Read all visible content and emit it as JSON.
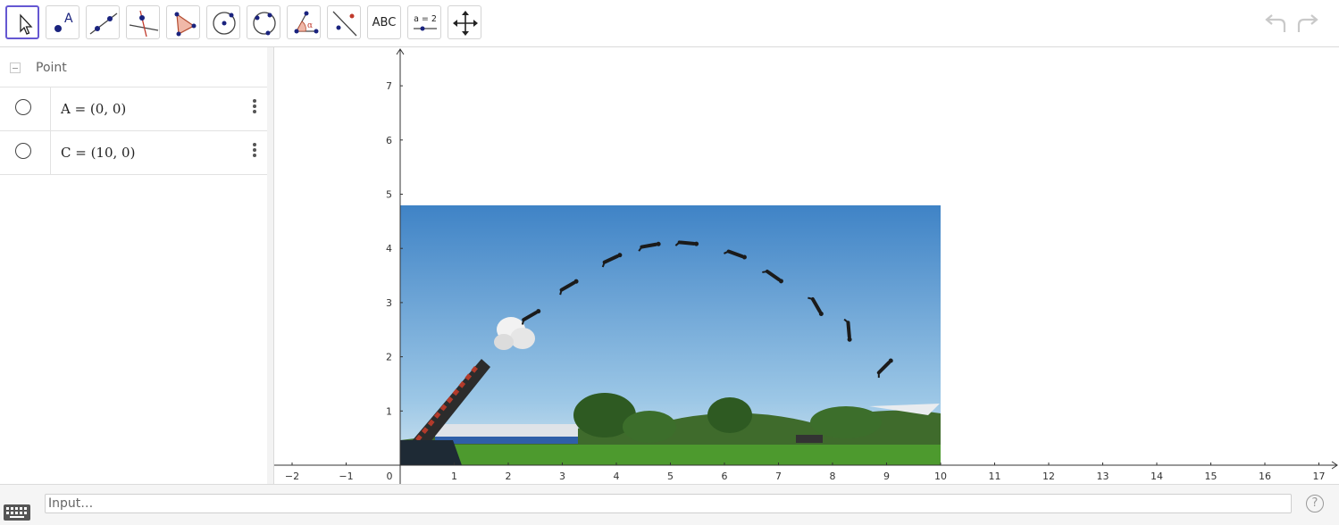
{
  "toolbar": {
    "tools": [
      {
        "name": "move-tool",
        "selected": true
      },
      {
        "name": "point-tool",
        "label": "A"
      },
      {
        "name": "line-tool"
      },
      {
        "name": "perpendicular-line-tool"
      },
      {
        "name": "polygon-tool"
      },
      {
        "name": "circle-with-center-tool"
      },
      {
        "name": "circle-through-three-points-tool"
      },
      {
        "name": "angle-tool",
        "label": "α"
      },
      {
        "name": "reflect-about-line-tool"
      },
      {
        "name": "text-tool",
        "label": "ABC"
      },
      {
        "name": "slider-tool",
        "label": "a = 2"
      },
      {
        "name": "move-graphics-view-tool"
      }
    ],
    "undo_icon": "undo-icon",
    "redo_icon": "redo-icon"
  },
  "algebra": {
    "group_label": "Point",
    "items": [
      {
        "definition": "A = (0, 0)"
      },
      {
        "definition": "C = (10, 0)"
      }
    ]
  },
  "graphics": {
    "x_ticks": [
      "−2",
      "−1",
      "0",
      "1",
      "2",
      "3",
      "4",
      "5",
      "6",
      "7",
      "8",
      "9",
      "10",
      "11",
      "12",
      "13",
      "14",
      "15",
      "16",
      "17"
    ],
    "y_ticks": [
      "1",
      "2",
      "3",
      "4",
      "5",
      "6",
      "7"
    ],
    "image": {
      "description": "cannon launching human cannonball, trajectory photo",
      "corner1": [
        0,
        0
      ],
      "corner2": [
        10,
        0
      ],
      "top": 4.8
    }
  },
  "input": {
    "placeholder": "Input…",
    "keyboard_icon": "keyboard-icon",
    "help_icon": "help-icon",
    "help_glyph": "?"
  },
  "colors": {
    "accent": "#6557d2",
    "point": "#1a237e",
    "axis": "#333333",
    "sky_top": "#3f83c6",
    "sky_bottom": "#9cc7e6",
    "grass": "#4d9a2e"
  }
}
